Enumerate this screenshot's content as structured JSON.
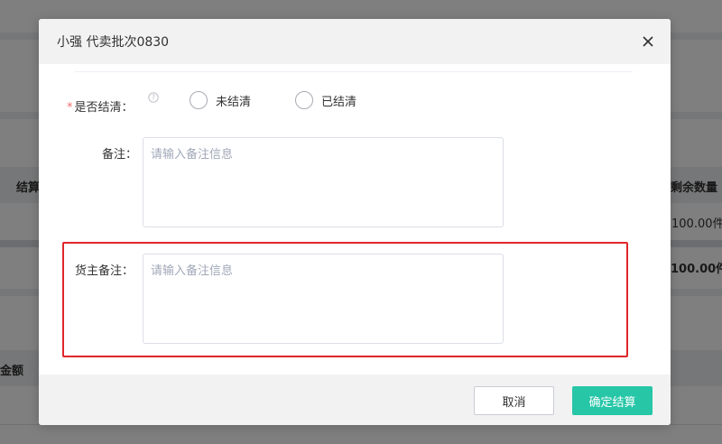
{
  "background": {
    "col_settlement": "结算",
    "col_remaining_qty": "剩余数量",
    "row_value": "100.00件",
    "total_value": "100.00件",
    "col_amount": "金额"
  },
  "dialog": {
    "title": "小强 代卖批次0830",
    "close_icon": "close-icon",
    "settled_field": {
      "required_mark": "*",
      "label": "是否结清：",
      "help_icon": "question-circle-icon",
      "options": [
        {
          "label": "未结清",
          "selected": false
        },
        {
          "label": "已结清",
          "selected": false
        }
      ]
    },
    "remark_field": {
      "label": "备注：",
      "value": "",
      "placeholder": "请输入备注信息"
    },
    "owner_remark_field": {
      "label": "货主备注：",
      "value": "",
      "placeholder": "请输入备注信息",
      "highlighted": true,
      "highlight_color": "#e0262a"
    },
    "footer": {
      "cancel_label": "取消",
      "confirm_label": "确定结算",
      "confirm_color": "#26c6a7"
    }
  }
}
